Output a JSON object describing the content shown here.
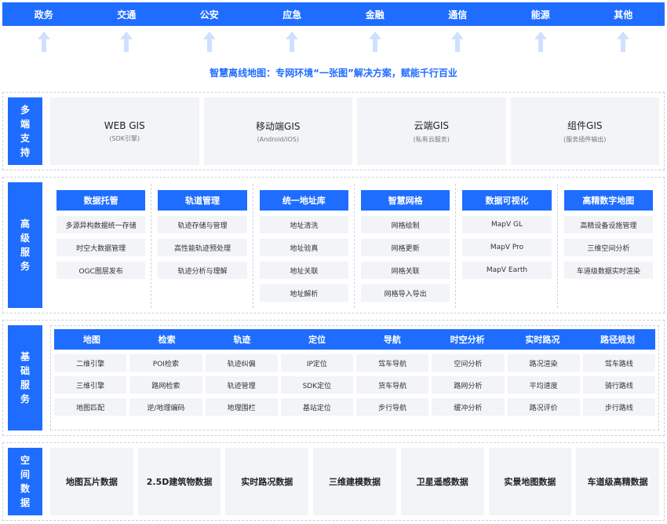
{
  "industries": [
    "政务",
    "交通",
    "公安",
    "应急",
    "金融",
    "通信",
    "能源",
    "其他"
  ],
  "tagline": "智慧离线地图：专网环境“一张图”解决方案，赋能千行百业",
  "multi_terminal": {
    "label": "多端支持",
    "cards": [
      {
        "title": "WEB GIS",
        "sub": "(SDK引擎)"
      },
      {
        "title": "移动端GIS",
        "sub": "(Android/iOS)"
      },
      {
        "title": "云端GIS",
        "sub": "(私有云服务)"
      },
      {
        "title": "组件GIS",
        "sub": "(服务插件输出)"
      }
    ]
  },
  "advanced_services": {
    "label": "高级服务",
    "columns": [
      {
        "title": "数据托管",
        "items": [
          "多源异构数据统一存储",
          "时空大数据管理",
          "OGC图层发布"
        ]
      },
      {
        "title": "轨道管理",
        "items": [
          "轨迹存储与管理",
          "高性能轨迹预处理",
          "轨迹分析与理解"
        ]
      },
      {
        "title": "统一地址库",
        "items": [
          "地址清洗",
          "地址验真",
          "地址关联",
          "地址解析"
        ]
      },
      {
        "title": "智慧网格",
        "items": [
          "网格绘制",
          "网格更新",
          "网格关联",
          "网格导入导出"
        ]
      },
      {
        "title": "数据可视化",
        "items": [
          "MapV GL",
          "MapV Pro",
          "MapV Earth"
        ]
      },
      {
        "title": "高精数字地图",
        "items": [
          "高精设备设施管理",
          "三维空间分析",
          "车道级数据实时渲染"
        ]
      }
    ]
  },
  "basic_services": {
    "label": "基础服务",
    "columns": [
      {
        "title": "地图",
        "items": [
          "二维引擎",
          "三维引擎",
          "地图匹配"
        ]
      },
      {
        "title": "检索",
        "items": [
          "POI检索",
          "路网检索",
          "逆/地理编码"
        ]
      },
      {
        "title": "轨迹",
        "items": [
          "轨迹纠偏",
          "轨迹管理",
          "地理围栏"
        ]
      },
      {
        "title": "定位",
        "items": [
          "IP定位",
          "SDK定位",
          "基站定位"
        ]
      },
      {
        "title": "导航",
        "items": [
          "驾车导航",
          "货车导航",
          "步行导航"
        ]
      },
      {
        "title": "时空分析",
        "items": [
          "空间分析",
          "路网分析",
          "缓冲分析"
        ]
      },
      {
        "title": "实时路况",
        "items": [
          "路况渲染",
          "平均速度",
          "路况评价"
        ]
      },
      {
        "title": "路径规划",
        "items": [
          "驾车路线",
          "骑行路线",
          "步行路线"
        ]
      }
    ]
  },
  "spatial_data": {
    "label": "空间数据",
    "cards": [
      "地图瓦片数据",
      "2.5D建筑物数据",
      "实时路况数据",
      "三维建模数据",
      "卫星遥感数据",
      "实景地图数据",
      "车道级高精数据"
    ]
  },
  "colors": {
    "accent": "#1f6dff",
    "card_bg": "#f2f4f7",
    "arrow": "#cfe0ff"
  }
}
